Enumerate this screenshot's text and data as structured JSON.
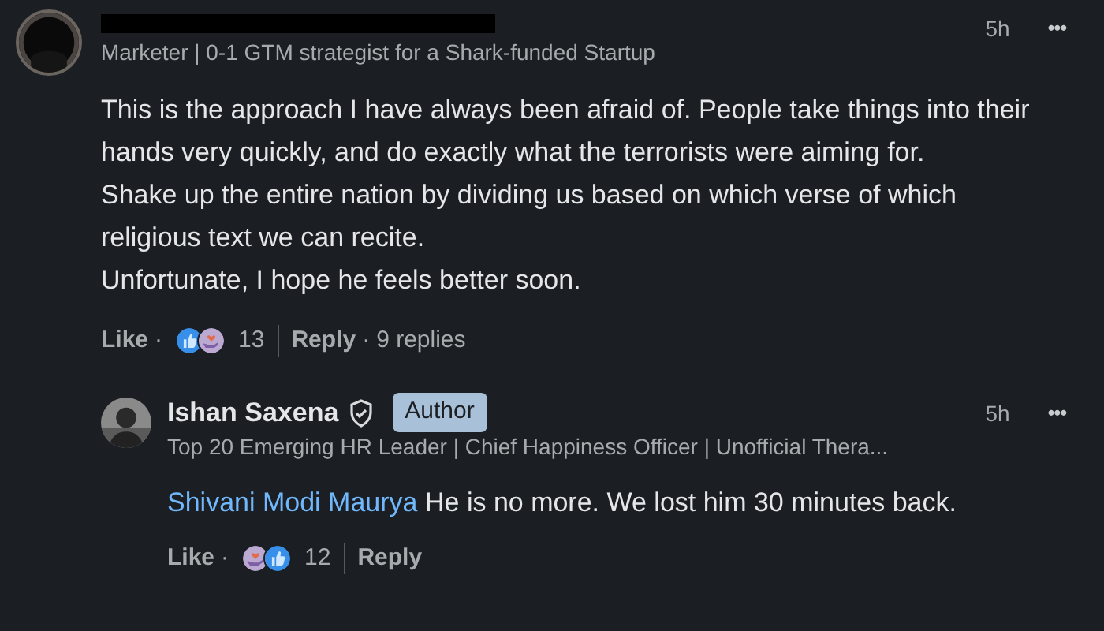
{
  "comments": [
    {
      "redacted": true,
      "headline": "Marketer | 0-1 GTM strategist for a Shark-funded Startup",
      "time": "5h",
      "more": "•••",
      "body": [
        "This is the approach I have always been afraid of. People take things into their hands very quickly, and do exactly what the terrorists were aiming for.",
        "Shake up the entire nation by dividing us based on which verse of which religious text we can recite.",
        "Unfortunate, I hope he feels better soon."
      ],
      "like": "Like",
      "dot": "·",
      "reactions": [
        {
          "kind": "like"
        },
        {
          "kind": "support"
        }
      ],
      "reaction_count": "13",
      "reply": "Reply",
      "replies_dot": "·",
      "replies_count": "9 replies",
      "replies": [
        {
          "author": "Ishan Saxena",
          "verified": true,
          "badge": "Author",
          "headline": "Top 20 Emerging HR Leader | Chief Happiness Officer | Unofficial Thera...",
          "time": "5h",
          "more": "•••",
          "mention": "Shivani Modi Maurya",
          "body": [
            "He is no more. We lost him 30 minutes back."
          ],
          "like": "Like",
          "dot": "·",
          "reactions": [
            {
              "kind": "support"
            },
            {
              "kind": "like"
            }
          ],
          "reaction_count": "12",
          "reply": "Reply"
        }
      ]
    }
  ]
}
